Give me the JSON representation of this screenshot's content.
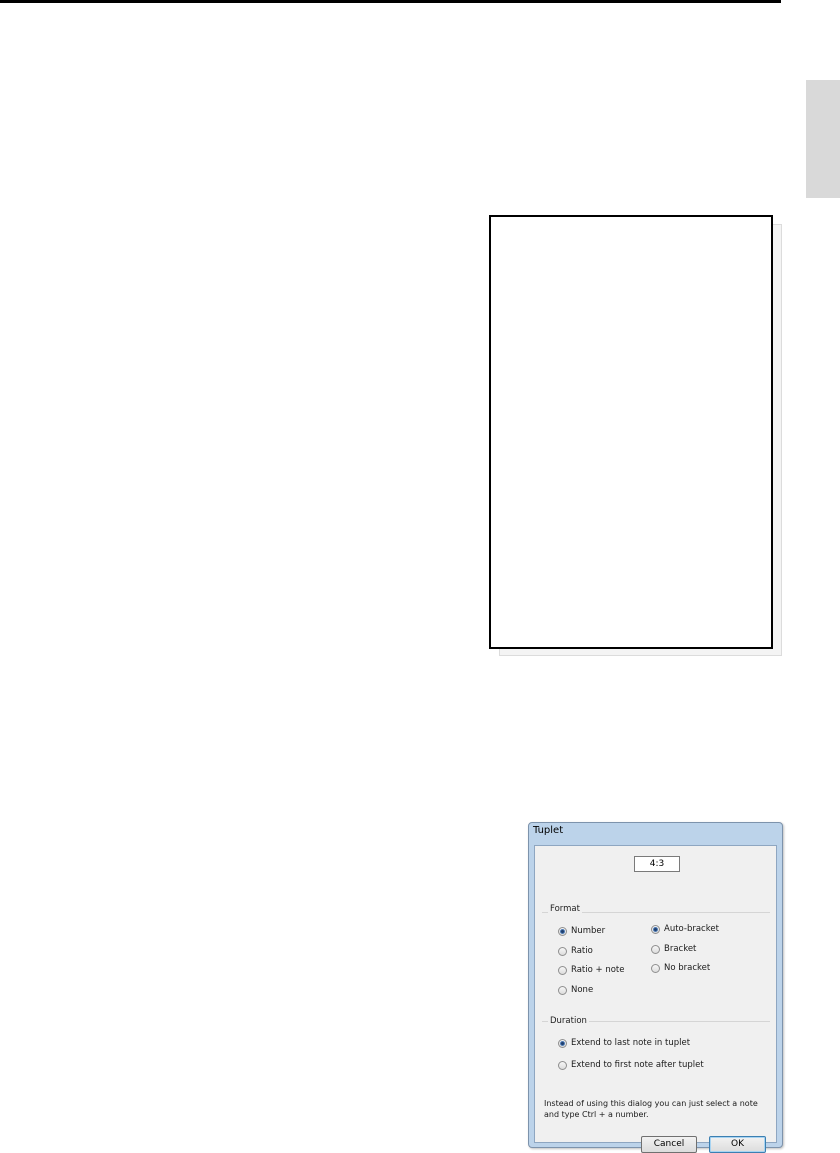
{
  "dialog": {
    "title": "Tuplet",
    "ratio_value": "4:3",
    "format": {
      "label": "Format",
      "number_options": [
        {
          "label": "Number",
          "checked": true
        },
        {
          "label": "Ratio",
          "checked": false
        },
        {
          "label": "Ratio + note",
          "checked": false
        },
        {
          "label": "None",
          "checked": false
        }
      ],
      "bracket_options": [
        {
          "label": "Auto-bracket",
          "checked": true
        },
        {
          "label": "Bracket",
          "checked": false
        },
        {
          "label": "No bracket",
          "checked": false
        }
      ]
    },
    "duration": {
      "label": "Duration",
      "options": [
        {
          "label": "Extend to last note in tuplet",
          "checked": true
        },
        {
          "label": "Extend to first note after tuplet",
          "checked": false
        }
      ]
    },
    "hint": "Instead of using this dialog you can just select a note and type Ctrl + a number.",
    "buttons": {
      "cancel": "Cancel",
      "ok": "OK"
    }
  }
}
